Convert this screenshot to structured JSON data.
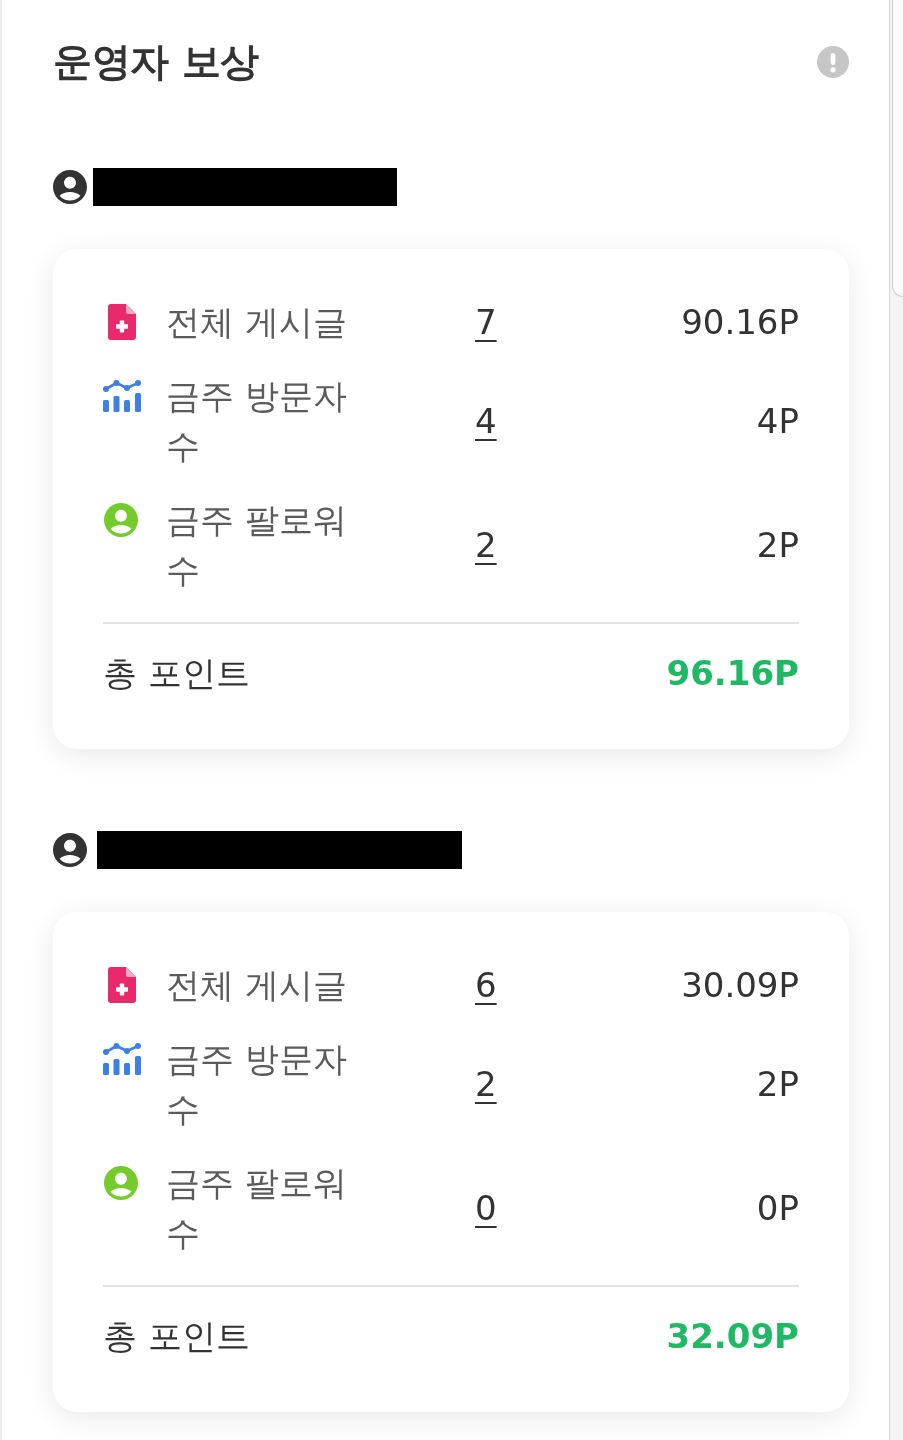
{
  "title": "운영자 보상",
  "operators": [
    {
      "stats": [
        {
          "kind": "posts",
          "label": "전체 게시글",
          "count": "7",
          "points": "90.16P"
        },
        {
          "kind": "visitors",
          "label": "금주 방문자 수",
          "count": "4",
          "points": "4P"
        },
        {
          "kind": "followers",
          "label": "금주 팔로워 수",
          "count": "2",
          "points": "2P"
        }
      ],
      "total": {
        "label": "총 포인트",
        "points": "96.16P"
      }
    },
    {
      "stats": [
        {
          "kind": "posts",
          "label": "전체 게시글",
          "count": "6",
          "points": "30.09P"
        },
        {
          "kind": "visitors",
          "label": "금주 방문자 수",
          "count": "2",
          "points": "2P"
        },
        {
          "kind": "followers",
          "label": "금주 팔로워 수",
          "count": "0",
          "points": "0P"
        }
      ],
      "total": {
        "label": "총 포인트",
        "points": "32.09P"
      }
    }
  ]
}
